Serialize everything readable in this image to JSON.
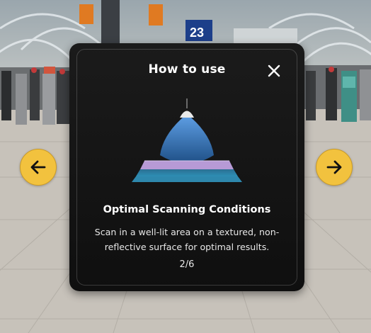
{
  "modal": {
    "title": "How to use",
    "heading": "Optimal Scanning Conditions",
    "description": "Scan in a well-lit area on a textured, non-reflective surface for optimal results.",
    "page_indicator": "2/6"
  },
  "icons": {
    "close": "close-icon",
    "previous": "arrow-left-icon",
    "next": "arrow-right-icon"
  },
  "background_sign": "23",
  "colors": {
    "nav_button": "#f2c23e",
    "modal_bg": "#141414",
    "beam": "#3f7fc6",
    "surface_top": "#b79ad6",
    "surface_bottom": "#2e7fa8"
  }
}
